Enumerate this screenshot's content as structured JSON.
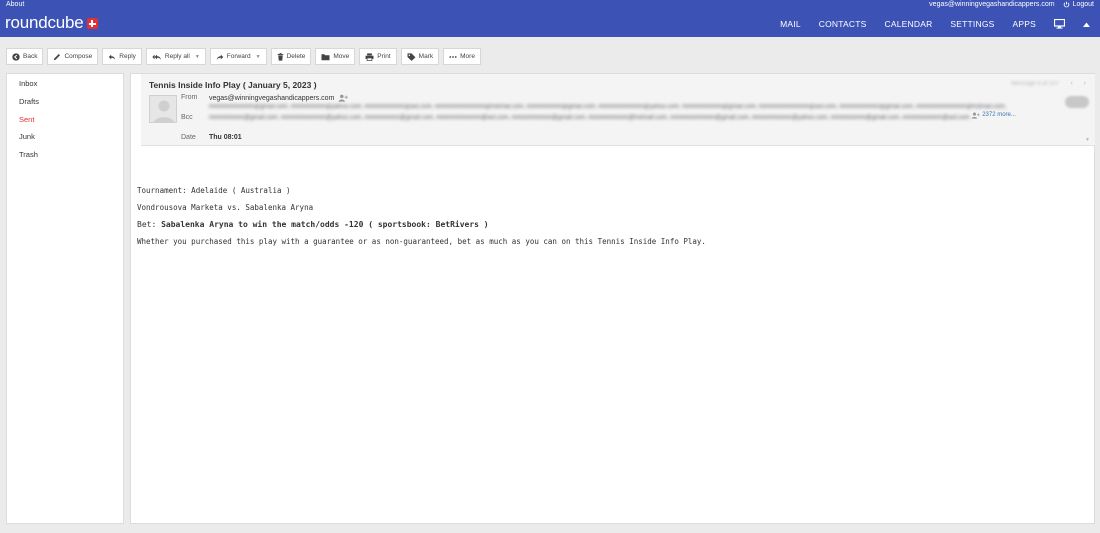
{
  "topbar": {
    "about": "About",
    "user_email": "vegas@winningvegashandicappers.com",
    "logout": "Logout",
    "logo_text": "roundcube",
    "nav": [
      "MAIL",
      "CONTACTS",
      "CALENDAR",
      "SETTINGS",
      "APPS"
    ]
  },
  "toolbar": {
    "back": "Back",
    "compose": "Compose",
    "reply": "Reply",
    "reply_all": "Reply all",
    "forward": "Forward",
    "delete": "Delete",
    "move": "Move",
    "print": "Print",
    "mark": "Mark",
    "more": "More"
  },
  "folders": [
    "Inbox",
    "Drafts",
    "Sent",
    "Junk",
    "Trash"
  ],
  "active_folder": "Sent",
  "message": {
    "subject": "Tennis Inside Info Play ( January 5, 2023 )",
    "counter": "Message 4 of 107",
    "from_label": "From",
    "from": "vegas@winningvegashandicappers.com",
    "bcc_label": "Bcc",
    "bcc_blurred": "mmmmmmmmm@gmail.com, mmmmmmm@yahoo.com, mmmmmmmm@aol.com, mmmmmmmmmm@hotmail.com, mmmmmmm@gmail.com, mmmmmmmmm@yahoo.com, mmmmmmmm@gmail.com, mmmmmmmmmm@aol.com, mmmmmmmm@gmail.com, mmmmmmmmmm@hotmail.com, mmmmmmm@gmail.com, mmmmmmmmm@yahoo.com, mmmmmmm@gmail.com, mmmmmmmmm@aol.com, mmmmmmmm@gmail.com, mmmmmmmm@hotmail.com, mmmmmmmmm@gmail.com, mmmmmmmm@yahoo.com, mmmmmmm@gmail.com, mmmmmmmm@aol.com",
    "bcc_more": "2372 more...",
    "date_label": "Date",
    "date": "Thu 08:01",
    "body": {
      "line1": "Tournament: Adelaide ( Australia )",
      "line2": "Vondrousova Marketa vs. Sabalenka Aryna",
      "bet_prefix": "Bet: ",
      "bet_text": "Sabalenka Aryna to win the match/odds -120 ( sportsbook: BetRivers )",
      "line4": "Whether you purchased this play with a guarantee or as non-guaranteed, bet as much as you can on this Tennis Inside Info Play."
    }
  },
  "colors": {
    "topbar": "#3c52b4",
    "active_folder": "#d9332f",
    "link": "#3c72b4",
    "logo_plus": "#e1303a"
  }
}
